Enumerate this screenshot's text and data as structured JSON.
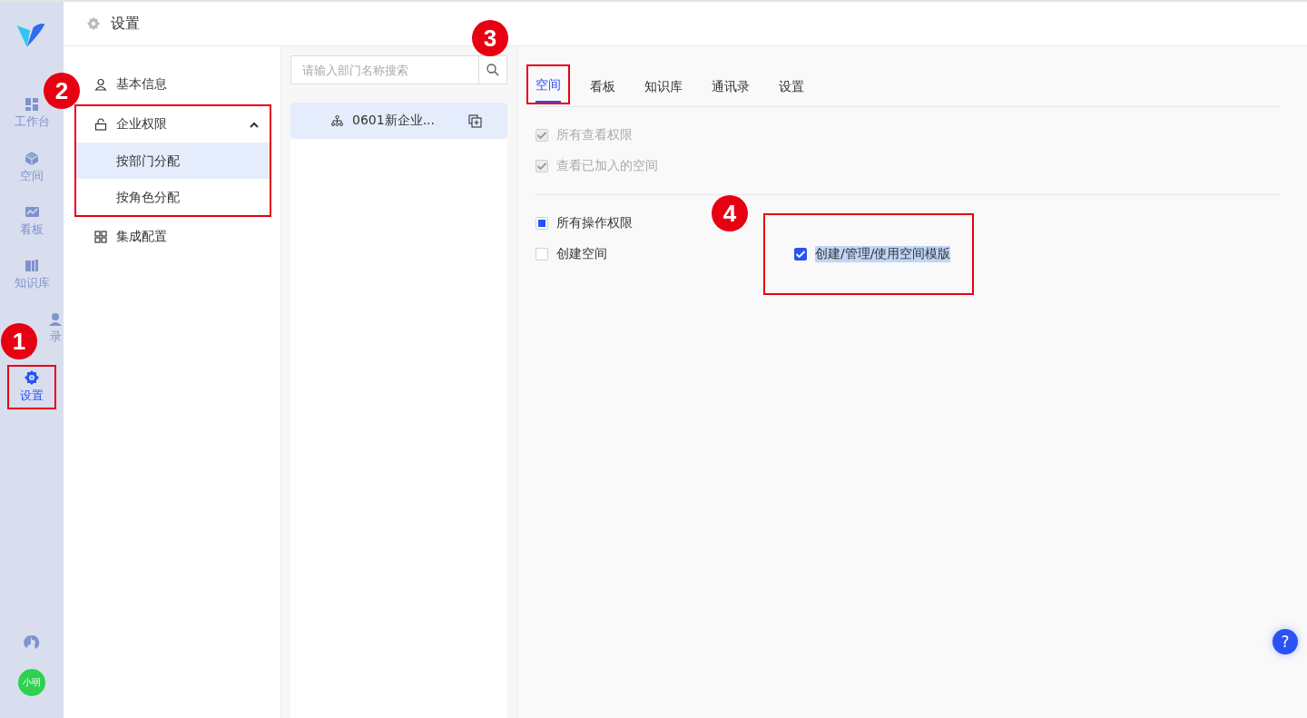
{
  "nav": {
    "items": [
      {
        "label": "工作台",
        "selected": false,
        "boxed": false
      },
      {
        "label": "空间",
        "selected": false,
        "boxed": false
      },
      {
        "label": "看板",
        "selected": false,
        "boxed": false
      },
      {
        "label": "知识库",
        "selected": false,
        "boxed": false
      },
      {
        "label": "录",
        "selected": false,
        "boxed": false,
        "kind": "partial"
      },
      {
        "label": "设置",
        "selected": true,
        "boxed": true
      }
    ],
    "avatar": "小明"
  },
  "header": {
    "title": "设置"
  },
  "menu": [
    {
      "label": "基本信息",
      "boxed": false
    },
    {
      "label": "企业权限",
      "boxed": true,
      "expanded": true,
      "children": [
        {
          "label": "按部门分配",
          "selected": true
        },
        {
          "label": "按角色分配",
          "selected": false
        }
      ]
    },
    {
      "label": "集成配置",
      "boxed": false
    }
  ],
  "dept": {
    "search": {
      "placeholder": "请输入部门名称搜索"
    },
    "items": [
      {
        "label": "0601新企业...",
        "selected": true
      }
    ]
  },
  "tabs": [
    {
      "label": "空间",
      "selected": true,
      "boxed": true
    },
    {
      "label": "看板",
      "selected": false,
      "boxed": false
    },
    {
      "label": "知识库",
      "selected": false,
      "boxed": false
    },
    {
      "label": "通讯录",
      "selected": false,
      "boxed": false
    },
    {
      "label": "设置",
      "selected": false,
      "boxed": false
    }
  ],
  "sections": [
    {
      "options": [
        {
          "label": "所有查看权限",
          "checked": true,
          "disabled": true
        },
        {
          "label": "查看已加入的空间",
          "checked": true,
          "disabled": true
        }
      ]
    },
    {
      "options": [
        {
          "label": "所有操作权限",
          "indeterminate": true,
          "disabled": false
        }
      ],
      "grid": [
        {
          "label": "创建空间",
          "checked": false,
          "disabled": false,
          "highlighted": false,
          "boxed": false
        },
        {
          "label": "创建/管理/使用空间模版",
          "checked": true,
          "disabled": false,
          "highlighted": true,
          "boxed": true
        }
      ]
    }
  ],
  "annotations": [
    {
      "label": "1"
    },
    {
      "label": "2"
    },
    {
      "label": "3"
    },
    {
      "label": "4"
    }
  ],
  "help": "?"
}
